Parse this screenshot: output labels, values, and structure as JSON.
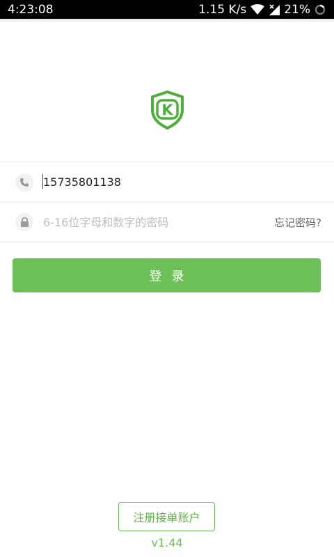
{
  "status_bar": {
    "time": "4:23:08",
    "network_speed": "1.15 K/s",
    "battery": "21%"
  },
  "colors": {
    "brand_green": "#6dc058",
    "logo_green": "#4caf3a"
  },
  "logo": {
    "letter": "K"
  },
  "form": {
    "phone_value": "15735801138",
    "password_placeholder": "6-16位字母和数字的密码",
    "forgot_password": "忘记密码?",
    "login_label": "登录"
  },
  "footer": {
    "register_label": "注册接单账户",
    "version": "v1.44"
  }
}
